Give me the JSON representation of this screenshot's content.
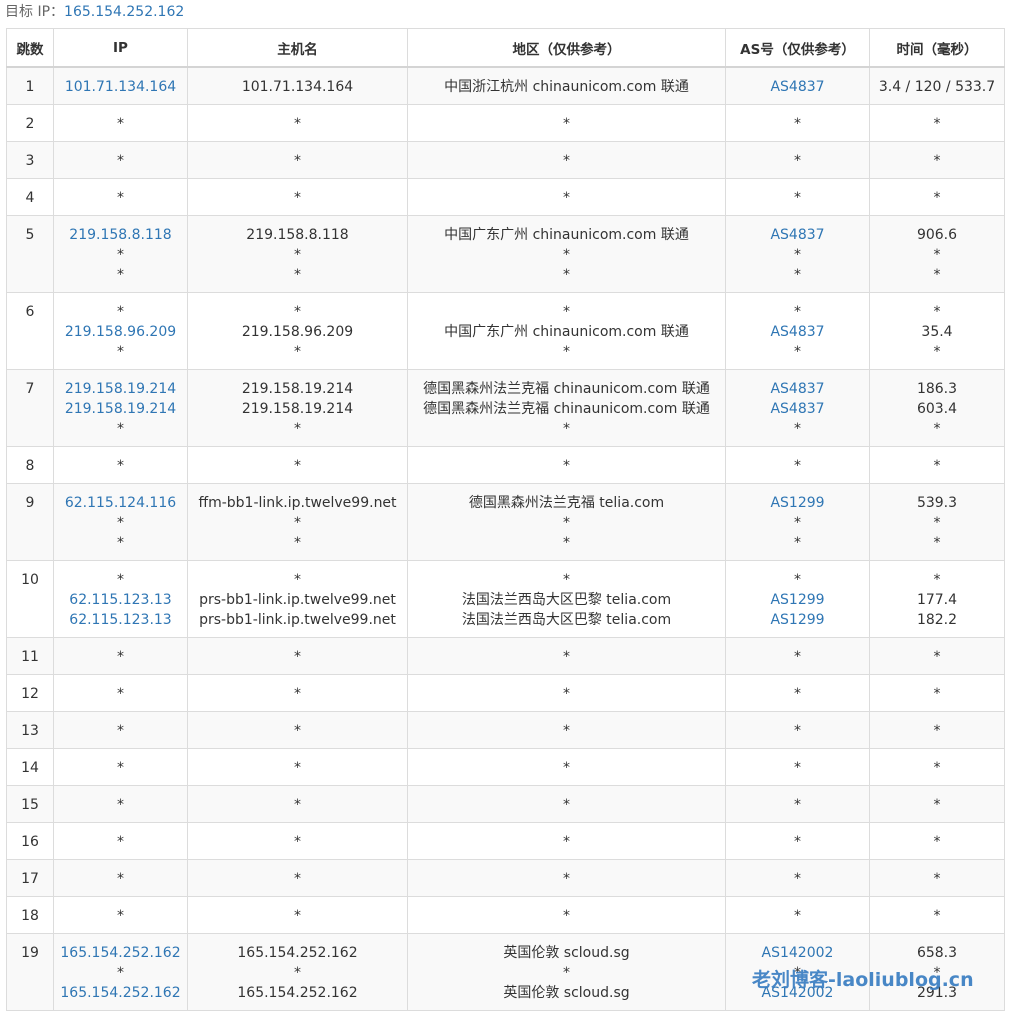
{
  "target": {
    "label": "目标 IP：",
    "ip": "165.154.252.162"
  },
  "headers": {
    "hop": "跳数",
    "ip": "IP",
    "host": "主机名",
    "region": "地区（仅供参考）",
    "as": "AS号（仅供参考）",
    "time": "时间（毫秒）"
  },
  "rows": [
    {
      "hop": "1",
      "ip": [
        "101.71.134.164"
      ],
      "host": [
        "101.71.134.164"
      ],
      "region": [
        "中国浙江杭州 chinaunicom.com 联通"
      ],
      "as": [
        "AS4837"
      ],
      "time": [
        "3.4 / 120 / 533.7"
      ]
    },
    {
      "hop": "2",
      "ip": [
        "*"
      ],
      "host": [
        "*"
      ],
      "region": [
        "*"
      ],
      "as": [
        "*"
      ],
      "time": [
        "*"
      ]
    },
    {
      "hop": "3",
      "ip": [
        "*"
      ],
      "host": [
        "*"
      ],
      "region": [
        "*"
      ],
      "as": [
        "*"
      ],
      "time": [
        "*"
      ]
    },
    {
      "hop": "4",
      "ip": [
        "*"
      ],
      "host": [
        "*"
      ],
      "region": [
        "*"
      ],
      "as": [
        "*"
      ],
      "time": [
        "*"
      ]
    },
    {
      "hop": "5",
      "ip": [
        "219.158.8.118",
        "*",
        "*"
      ],
      "host": [
        "219.158.8.118",
        "*",
        "*"
      ],
      "region": [
        "中国广东广州 chinaunicom.com 联通",
        "*",
        "*"
      ],
      "as": [
        "AS4837",
        "*",
        "*"
      ],
      "time": [
        "906.6",
        "*",
        "*"
      ]
    },
    {
      "hop": "6",
      "ip": [
        "*",
        "219.158.96.209",
        "*"
      ],
      "host": [
        "*",
        "219.158.96.209",
        "*"
      ],
      "region": [
        "*",
        "中国广东广州 chinaunicom.com 联通",
        "*"
      ],
      "as": [
        "*",
        "AS4837",
        "*"
      ],
      "time": [
        "*",
        "35.4",
        "*"
      ]
    },
    {
      "hop": "7",
      "ip": [
        "219.158.19.214",
        "219.158.19.214",
        "*"
      ],
      "host": [
        "219.158.19.214",
        "219.158.19.214",
        "*"
      ],
      "region": [
        "德国黑森州法兰克福 chinaunicom.com 联通",
        "德国黑森州法兰克福 chinaunicom.com 联通",
        "*"
      ],
      "as": [
        "AS4837",
        "AS4837",
        "*"
      ],
      "time": [
        "186.3",
        "603.4",
        "*"
      ]
    },
    {
      "hop": "8",
      "ip": [
        "*"
      ],
      "host": [
        "*"
      ],
      "region": [
        "*"
      ],
      "as": [
        "*"
      ],
      "time": [
        "*"
      ]
    },
    {
      "hop": "9",
      "ip": [
        "62.115.124.116",
        "*",
        "*"
      ],
      "host": [
        "ffm-bb1-link.ip.twelve99.net",
        "*",
        "*"
      ],
      "region": [
        "德国黑森州法兰克福 telia.com",
        "*",
        "*"
      ],
      "as": [
        "AS1299",
        "*",
        "*"
      ],
      "time": [
        "539.3",
        "*",
        "*"
      ]
    },
    {
      "hop": "10",
      "ip": [
        "*",
        "62.115.123.13",
        "62.115.123.13"
      ],
      "host": [
        "*",
        "prs-bb1-link.ip.twelve99.net",
        "prs-bb1-link.ip.twelve99.net"
      ],
      "region": [
        "*",
        "法国法兰西岛大区巴黎 telia.com",
        "法国法兰西岛大区巴黎 telia.com"
      ],
      "as": [
        "*",
        "AS1299",
        "AS1299"
      ],
      "time": [
        "*",
        "177.4",
        "182.2"
      ]
    },
    {
      "hop": "11",
      "ip": [
        "*"
      ],
      "host": [
        "*"
      ],
      "region": [
        "*"
      ],
      "as": [
        "*"
      ],
      "time": [
        "*"
      ]
    },
    {
      "hop": "12",
      "ip": [
        "*"
      ],
      "host": [
        "*"
      ],
      "region": [
        "*"
      ],
      "as": [
        "*"
      ],
      "time": [
        "*"
      ]
    },
    {
      "hop": "13",
      "ip": [
        "*"
      ],
      "host": [
        "*"
      ],
      "region": [
        "*"
      ],
      "as": [
        "*"
      ],
      "time": [
        "*"
      ]
    },
    {
      "hop": "14",
      "ip": [
        "*"
      ],
      "host": [
        "*"
      ],
      "region": [
        "*"
      ],
      "as": [
        "*"
      ],
      "time": [
        "*"
      ]
    },
    {
      "hop": "15",
      "ip": [
        "*"
      ],
      "host": [
        "*"
      ],
      "region": [
        "*"
      ],
      "as": [
        "*"
      ],
      "time": [
        "*"
      ]
    },
    {
      "hop": "16",
      "ip": [
        "*"
      ],
      "host": [
        "*"
      ],
      "region": [
        "*"
      ],
      "as": [
        "*"
      ],
      "time": [
        "*"
      ]
    },
    {
      "hop": "17",
      "ip": [
        "*"
      ],
      "host": [
        "*"
      ],
      "region": [
        "*"
      ],
      "as": [
        "*"
      ],
      "time": [
        "*"
      ]
    },
    {
      "hop": "18",
      "ip": [
        "*"
      ],
      "host": [
        "*"
      ],
      "region": [
        "*"
      ],
      "as": [
        "*"
      ],
      "time": [
        "*"
      ]
    },
    {
      "hop": "19",
      "ip": [
        "165.154.252.162",
        "*",
        "165.154.252.162"
      ],
      "host": [
        "165.154.252.162",
        "*",
        "165.154.252.162"
      ],
      "region": [
        "英国伦敦 scloud.sg",
        "*",
        "英国伦敦 scloud.sg"
      ],
      "as": [
        "AS142002",
        "*",
        "AS142002"
      ],
      "time": [
        "658.3",
        "*",
        "291.3"
      ]
    }
  ],
  "watermark": "老刘博客-laoliublog.cn",
  "colors": {
    "link": "#2f76b4",
    "stripe": "#f9f9f9",
    "border": "#dcdcdc"
  }
}
